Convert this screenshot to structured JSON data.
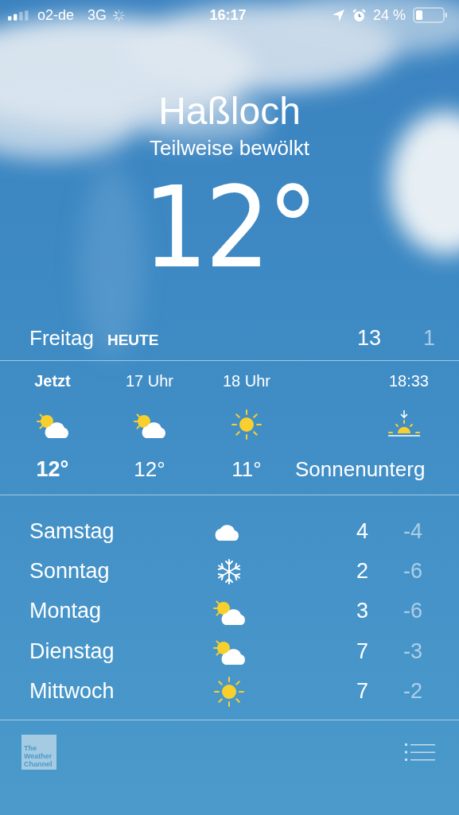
{
  "status_bar": {
    "carrier": "o2-de",
    "network": "3G",
    "time": "16:17",
    "battery": "24 %"
  },
  "location": {
    "city": "Haßloch",
    "condition": "Teilweise bewölkt",
    "temperature": "12°"
  },
  "today": {
    "day": "Freitag",
    "label": "HEUTE",
    "high": "13",
    "low": "1"
  },
  "hourly": [
    {
      "time": "Jetzt",
      "kind": "partly-cloudy",
      "value": "12°",
      "current": true
    },
    {
      "time": "17 Uhr",
      "kind": "partly-cloudy",
      "value": "12°",
      "current": false
    },
    {
      "time": "18 Uhr",
      "kind": "sunny",
      "value": "11°",
      "current": false
    },
    {
      "time": "18:33",
      "kind": "sunset",
      "value": "Sonnenunterg",
      "current": false
    }
  ],
  "daily": [
    {
      "day": "Samstag",
      "kind": "cloudy",
      "high": "4",
      "low": "-4"
    },
    {
      "day": "Sonntag",
      "kind": "snow",
      "high": "2",
      "low": "-6"
    },
    {
      "day": "Montag",
      "kind": "partly-cloudy",
      "high": "3",
      "low": "-6"
    },
    {
      "day": "Dienstag",
      "kind": "partly-cloudy",
      "high": "7",
      "low": "-3"
    },
    {
      "day": "Mittwoch",
      "kind": "sunny",
      "high": "7",
      "low": "-2"
    }
  ],
  "footer": {
    "logo": "The Weather Channel"
  }
}
